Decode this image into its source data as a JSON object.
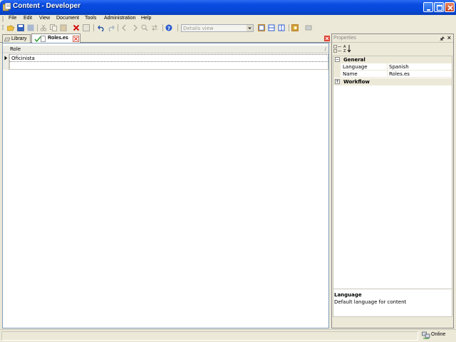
{
  "window": {
    "title": "Content - Developer"
  },
  "menu": [
    "File",
    "Edit",
    "View",
    "Document",
    "Tools",
    "Administration",
    "Help"
  ],
  "toolbar": {
    "view_select_value": "Details view"
  },
  "tabs": [
    {
      "label": "Library",
      "active": false
    },
    {
      "label": "Roles.es",
      "active": true
    }
  ],
  "grid": {
    "column_header": "Role",
    "rows": [
      "Oficinista"
    ]
  },
  "properties": {
    "title": "Properties",
    "categories": [
      {
        "name": "General",
        "expanded": true,
        "rows": [
          {
            "name": "Language",
            "value": "Spanish"
          },
          {
            "name": "Name",
            "value": "Roles.es"
          }
        ]
      },
      {
        "name": "Workflow",
        "expanded": false,
        "rows": []
      }
    ],
    "description": {
      "title": "Language",
      "text": "Default language for content"
    }
  },
  "status": {
    "connection": "Online"
  },
  "colors": {
    "titlebar": "#0548d8",
    "chrome": "#ece9d8",
    "tab_close": "#e04030"
  }
}
